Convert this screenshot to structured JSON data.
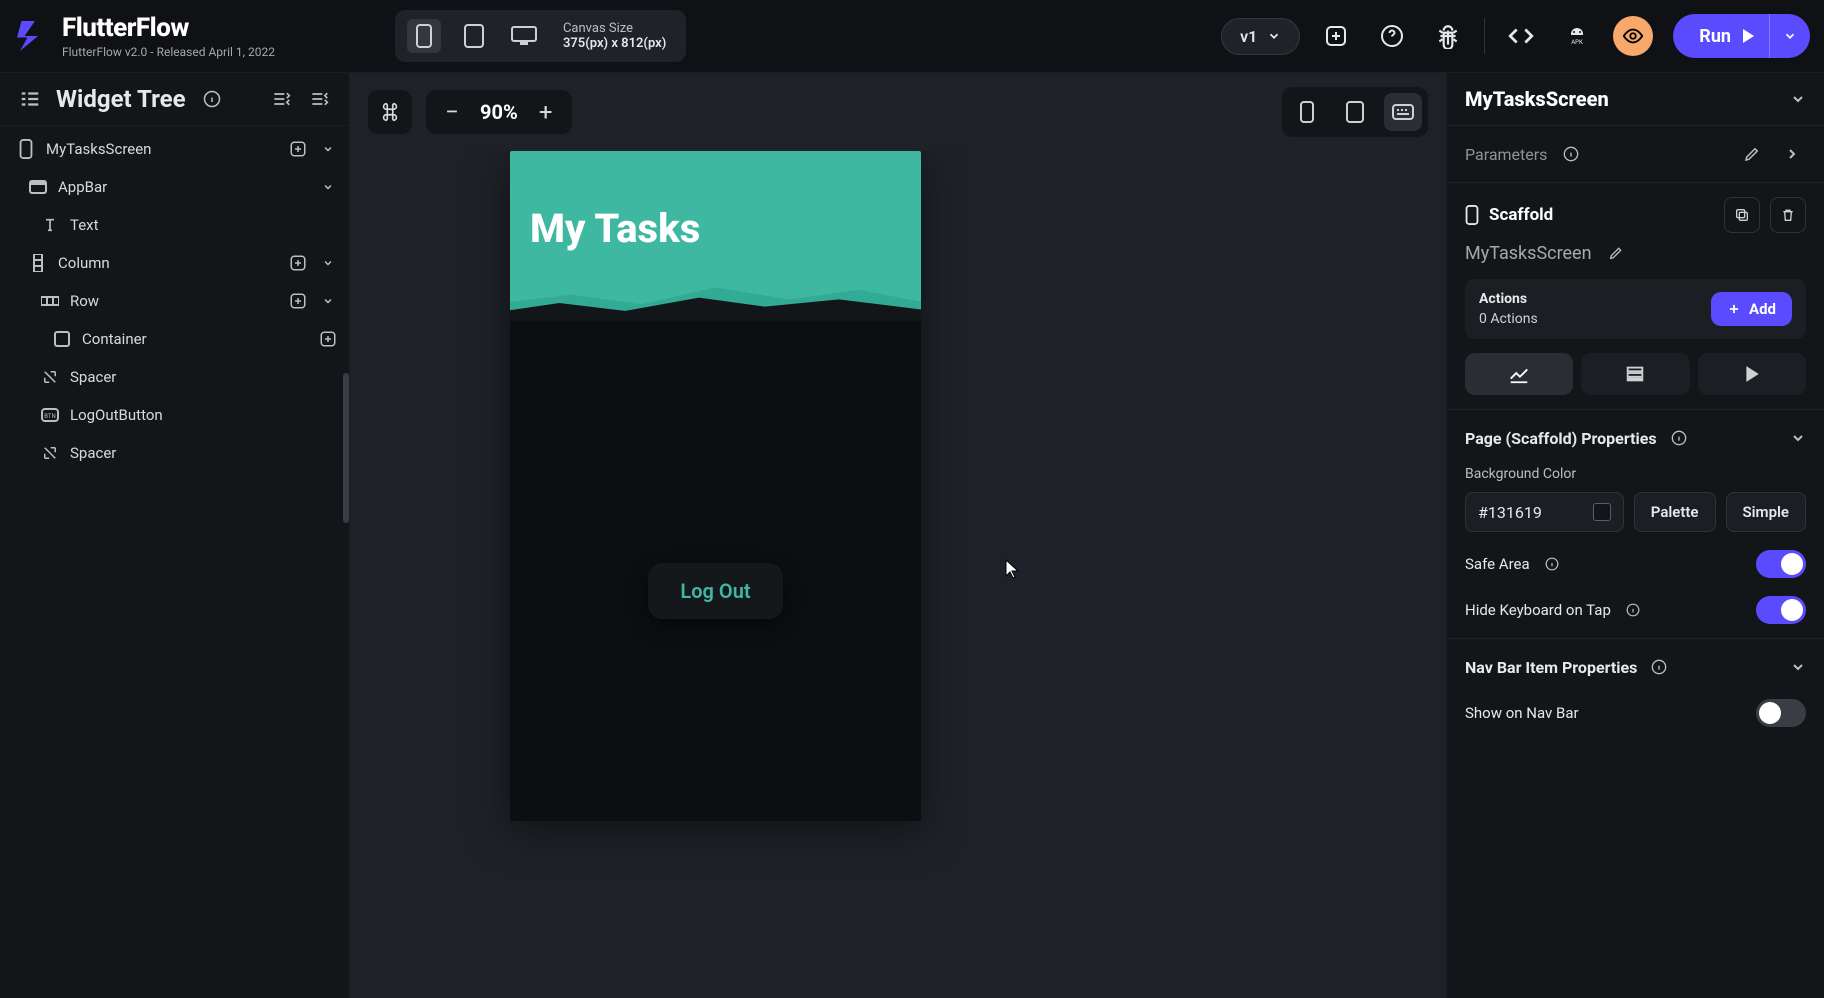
{
  "app": {
    "name": "FlutterFlow",
    "version_line": "FlutterFlow v2.0 - Released April 1, 2022"
  },
  "topbar": {
    "canvas_size_label": "Canvas Size",
    "canvas_size_value": "375(px) x 812(px)",
    "version": "v1",
    "run_label": "Run"
  },
  "left": {
    "title": "Widget Tree",
    "tree": [
      {
        "label": "MyTasksScreen",
        "depth": 0,
        "icon": "phone",
        "add": true,
        "chevron": true
      },
      {
        "label": "AppBar",
        "depth": 1,
        "icon": "appbar",
        "add": false,
        "chevron": true
      },
      {
        "label": "Text",
        "depth": 2,
        "icon": "text",
        "add": false,
        "chevron": false
      },
      {
        "label": "Column",
        "depth": 1,
        "icon": "column",
        "add": true,
        "chevron": true
      },
      {
        "label": "Row",
        "depth": 2,
        "icon": "row",
        "add": true,
        "chevron": true
      },
      {
        "label": "Container",
        "depth": 3,
        "icon": "container",
        "add": true,
        "chevron": false
      },
      {
        "label": "Spacer",
        "depth": 2,
        "icon": "spacer",
        "add": false,
        "chevron": false
      },
      {
        "label": "LogOutButton",
        "depth": 2,
        "icon": "button",
        "add": false,
        "chevron": false
      },
      {
        "label": "Spacer",
        "depth": 2,
        "icon": "spacer",
        "add": false,
        "chevron": false
      }
    ]
  },
  "center": {
    "zoom": "90%",
    "phone_title": "My Tasks",
    "logout_label": "Log Out"
  },
  "right": {
    "page_name": "MyTasksScreen",
    "parameters_label": "Parameters",
    "scaffold_label": "Scaffold",
    "scaffold_sub": "MyTasksScreen",
    "actions_title": "Actions",
    "actions_count": "0 Actions",
    "add_label": "Add",
    "scaffold_props_title": "Page (Scaffold) Properties",
    "bg_label": "Background Color",
    "bg_value": "#131619",
    "palette_label": "Palette",
    "simple_label": "Simple",
    "safe_area_label": "Safe Area",
    "hide_kb_label": "Hide Keyboard on Tap",
    "navbar_props_title": "Nav Bar Item Properties",
    "show_nav_label": "Show on Nav Bar"
  }
}
